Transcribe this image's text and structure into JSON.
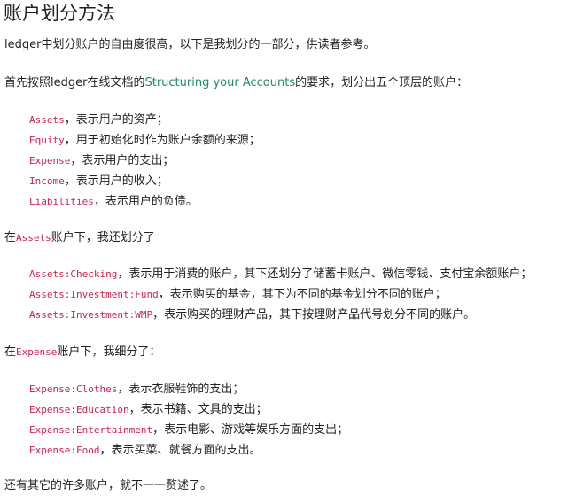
{
  "title": "账户划分方法",
  "intro": "ledger中划分账户的自由度很高，以下是我划分的一部分，供读者参考。",
  "top_section": {
    "before": "首先按照ledger在线文档的",
    "link": "Structuring your Accounts",
    "after": "的要求，划分出五个顶层的账户："
  },
  "top_accounts": [
    {
      "code": "Assets",
      "desc": "，表示用户的资产；"
    },
    {
      "code": "Equity",
      "desc": "，用于初始化时作为账户余额的来源；"
    },
    {
      "code": "Expense",
      "desc": "，表示用户的支出；"
    },
    {
      "code": "Income",
      "desc": "，表示用户的收入；"
    },
    {
      "code": "Liabilities",
      "desc": "，表示用户的负债。"
    }
  ],
  "assets_section": {
    "before": "在",
    "code": "Assets",
    "after": "账户下，我还划分了"
  },
  "assets_accounts": [
    {
      "code": "Assets:Checking",
      "desc": "，表示用于消费的账户，其下还划分了储蓄卡账户、微信零钱、支付宝余额账户；"
    },
    {
      "code": "Assets:Investment:Fund",
      "desc": "，表示购买的基金，其下为不同的基金划分不同的账户；"
    },
    {
      "code": "Assets:Investment:WMP",
      "desc": "，表示购买的理财产品，其下按理财产品代号划分不同的账户。"
    }
  ],
  "expense_section": {
    "before": "在",
    "code": "Expense",
    "after": "账户下，我细分了："
  },
  "expense_accounts": [
    {
      "code": "Expense:Clothes",
      "desc": "，表示衣服鞋饰的支出；"
    },
    {
      "code": "Expense:Education",
      "desc": "，表示书籍、文具的支出；"
    },
    {
      "code": "Expense:Entertainment",
      "desc": "，表示电影、游戏等娱乐方面的支出；"
    },
    {
      "code": "Expense:Food",
      "desc": "，表示买菜、就餐方面的支出。"
    }
  ],
  "outro": "还有其它的许多账户，就不一一赘述了。",
  "colors": {
    "code": "#c7254e",
    "link": "#1e8a6e",
    "text": "#222222"
  }
}
